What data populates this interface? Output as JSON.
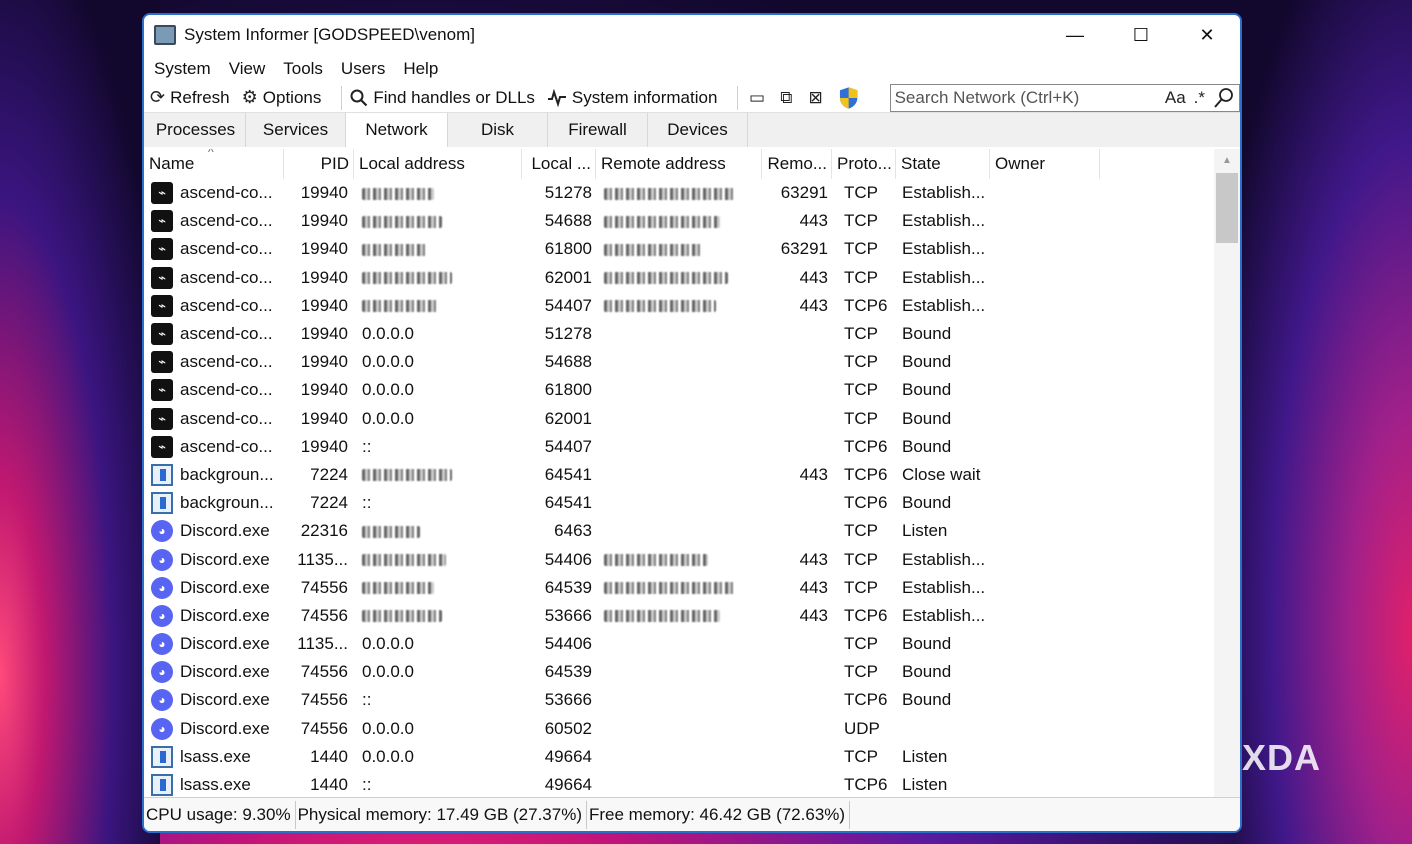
{
  "window": {
    "title": "System Informer [GODSPEED\\venom]",
    "controls": {
      "minimize": "—",
      "maximize": "☐",
      "close": "✕"
    }
  },
  "menu": [
    "System",
    "View",
    "Tools",
    "Users",
    "Help"
  ],
  "toolbar": {
    "refresh": "Refresh",
    "options": "Options",
    "find": "Find handles or DLLs",
    "sysinfo": "System information",
    "search_placeholder": "Search Network (Ctrl+K)",
    "search_case": "Aa",
    "search_regex": ".*"
  },
  "tabs": [
    {
      "label": "Processes",
      "active": false
    },
    {
      "label": "Services",
      "active": false
    },
    {
      "label": "Network",
      "active": true
    },
    {
      "label": "Disk",
      "active": false
    },
    {
      "label": "Firewall",
      "active": false
    },
    {
      "label": "Devices",
      "active": false
    }
  ],
  "columns": {
    "name": "Name",
    "pid": "PID",
    "local_address": "Local address",
    "local_port": "Local ...",
    "remote_address": "Remote address",
    "remote_port": "Remo...",
    "protocol": "Proto...",
    "state": "State",
    "owner": "Owner"
  },
  "rows": [
    {
      "icon": "ascend",
      "name": "ascend-co...",
      "pid": "19940",
      "laddr": "",
      "laddr_blurred": true,
      "lport": "51278",
      "raddr": "",
      "raddr_blurred": true,
      "rport": "63291",
      "proto": "TCP",
      "state": "Establish..."
    },
    {
      "icon": "ascend",
      "name": "ascend-co...",
      "pid": "19940",
      "laddr": "",
      "laddr_blurred": true,
      "lport": "54688",
      "raddr": "",
      "raddr_blurred": true,
      "rport": "443",
      "proto": "TCP",
      "state": "Establish..."
    },
    {
      "icon": "ascend",
      "name": "ascend-co...",
      "pid": "19940",
      "laddr": "",
      "laddr_blurred": true,
      "lport": "61800",
      "raddr": "",
      "raddr_blurred": true,
      "rport": "63291",
      "proto": "TCP",
      "state": "Establish..."
    },
    {
      "icon": "ascend",
      "name": "ascend-co...",
      "pid": "19940",
      "laddr": "",
      "laddr_blurred": true,
      "lport": "62001",
      "raddr": "",
      "raddr_blurred": true,
      "rport": "443",
      "proto": "TCP",
      "state": "Establish..."
    },
    {
      "icon": "ascend",
      "name": "ascend-co...",
      "pid": "19940",
      "laddr": "",
      "laddr_blurred": true,
      "lport": "54407",
      "raddr": "",
      "raddr_blurred": true,
      "rport": "443",
      "proto": "TCP6",
      "state": "Establish..."
    },
    {
      "icon": "ascend",
      "name": "ascend-co...",
      "pid": "19940",
      "laddr": "0.0.0.0",
      "laddr_blurred": false,
      "lport": "51278",
      "raddr": "",
      "raddr_blurred": false,
      "rport": "",
      "proto": "TCP",
      "state": "Bound"
    },
    {
      "icon": "ascend",
      "name": "ascend-co...",
      "pid": "19940",
      "laddr": "0.0.0.0",
      "laddr_blurred": false,
      "lport": "54688",
      "raddr": "",
      "raddr_blurred": false,
      "rport": "",
      "proto": "TCP",
      "state": "Bound"
    },
    {
      "icon": "ascend",
      "name": "ascend-co...",
      "pid": "19940",
      "laddr": "0.0.0.0",
      "laddr_blurred": false,
      "lport": "61800",
      "raddr": "",
      "raddr_blurred": false,
      "rport": "",
      "proto": "TCP",
      "state": "Bound"
    },
    {
      "icon": "ascend",
      "name": "ascend-co...",
      "pid": "19940",
      "laddr": "0.0.0.0",
      "laddr_blurred": false,
      "lport": "62001",
      "raddr": "",
      "raddr_blurred": false,
      "rport": "",
      "proto": "TCP",
      "state": "Bound"
    },
    {
      "icon": "ascend",
      "name": "ascend-co...",
      "pid": "19940",
      "laddr": "::",
      "laddr_blurred": false,
      "lport": "54407",
      "raddr": "",
      "raddr_blurred": false,
      "rport": "",
      "proto": "TCP6",
      "state": "Bound"
    },
    {
      "icon": "bg",
      "name": "backgroun...",
      "pid": "7224",
      "laddr": "",
      "laddr_blurred": true,
      "lport": "64541",
      "raddr": "",
      "raddr_blurred": false,
      "rport": "443",
      "proto": "TCP6",
      "state": "Close wait"
    },
    {
      "icon": "bg",
      "name": "backgroun...",
      "pid": "7224",
      "laddr": "::",
      "laddr_blurred": false,
      "lport": "64541",
      "raddr": "",
      "raddr_blurred": false,
      "rport": "",
      "proto": "TCP6",
      "state": "Bound"
    },
    {
      "icon": "discord",
      "name": "Discord.exe",
      "pid": "22316",
      "laddr": "",
      "laddr_blurred": true,
      "lport": "6463",
      "raddr": "",
      "raddr_blurred": false,
      "rport": "",
      "proto": "TCP",
      "state": "Listen"
    },
    {
      "icon": "discord",
      "name": "Discord.exe",
      "pid": "1135...",
      "laddr": "",
      "laddr_blurred": true,
      "lport": "54406",
      "raddr": "",
      "raddr_blurred": true,
      "rport": "443",
      "proto": "TCP",
      "state": "Establish..."
    },
    {
      "icon": "discord",
      "name": "Discord.exe",
      "pid": "74556",
      "laddr": "",
      "laddr_blurred": true,
      "lport": "64539",
      "raddr": "",
      "raddr_blurred": true,
      "rport": "443",
      "proto": "TCP",
      "state": "Establish..."
    },
    {
      "icon": "discord",
      "name": "Discord.exe",
      "pid": "74556",
      "laddr": "",
      "laddr_blurred": true,
      "lport": "53666",
      "raddr": "",
      "raddr_blurred": true,
      "rport": "443",
      "proto": "TCP6",
      "state": "Establish..."
    },
    {
      "icon": "discord",
      "name": "Discord.exe",
      "pid": "1135...",
      "laddr": "0.0.0.0",
      "laddr_blurred": false,
      "lport": "54406",
      "raddr": "",
      "raddr_blurred": false,
      "rport": "",
      "proto": "TCP",
      "state": "Bound"
    },
    {
      "icon": "discord",
      "name": "Discord.exe",
      "pid": "74556",
      "laddr": "0.0.0.0",
      "laddr_blurred": false,
      "lport": "64539",
      "raddr": "",
      "raddr_blurred": false,
      "rport": "",
      "proto": "TCP",
      "state": "Bound"
    },
    {
      "icon": "discord",
      "name": "Discord.exe",
      "pid": "74556",
      "laddr": "::",
      "laddr_blurred": false,
      "lport": "53666",
      "raddr": "",
      "raddr_blurred": false,
      "rport": "",
      "proto": "TCP6",
      "state": "Bound"
    },
    {
      "icon": "discord",
      "name": "Discord.exe",
      "pid": "74556",
      "laddr": "0.0.0.0",
      "laddr_blurred": false,
      "lport": "60502",
      "raddr": "",
      "raddr_blurred": false,
      "rport": "",
      "proto": "UDP",
      "state": ""
    },
    {
      "icon": "lsass",
      "name": "lsass.exe",
      "pid": "1440",
      "laddr": "0.0.0.0",
      "laddr_blurred": false,
      "lport": "49664",
      "raddr": "",
      "raddr_blurred": false,
      "rport": "",
      "proto": "TCP",
      "state": "Listen"
    },
    {
      "icon": "lsass",
      "name": "lsass.exe",
      "pid": "1440",
      "laddr": "::",
      "laddr_blurred": false,
      "lport": "49664",
      "raddr": "",
      "raddr_blurred": false,
      "rport": "",
      "proto": "TCP6",
      "state": "Listen"
    }
  ],
  "status": {
    "cpu": "CPU usage: 9.30%",
    "physical": "Physical memory: 17.49 GB (27.37%)",
    "free": "Free memory: 46.42 GB (72.63%)"
  },
  "watermark": "XDA",
  "colors": {
    "accent": "#2a6fc9",
    "discord": "#5865f2"
  }
}
